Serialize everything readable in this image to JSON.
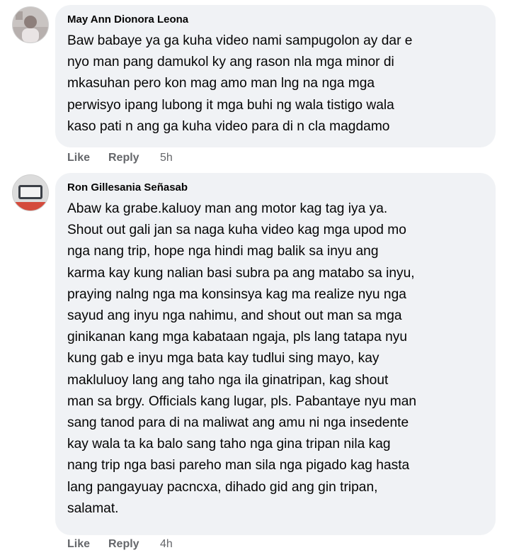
{
  "comments": [
    {
      "author": "May Ann Dionora Leona",
      "lines": [
        "Baw babaye ya ga kuha video nami sampugolon ay dar e",
        "nyo man pang damukol ky ang rason nla mga minor di",
        "mkasuhan pero kon mag amo man lng na nga mga",
        "perwisyo ipang lubong it mga buhi ng wala tistigo wala",
        "kaso pati n ang ga kuha video para di n cla magdamo"
      ],
      "like_label": "Like",
      "reply_label": "Reply",
      "time": "5h"
    },
    {
      "author": "Ron Gillesania Señasab",
      "lines": [
        "Abaw ka grabe.kaluoy man ang motor kag tag iya ya.",
        "Shout out gali jan sa naga kuha video kag mga upod mo",
        "nga nang trip, hope nga hindi mag balik sa inyu ang",
        "karma kay kung nalian basi subra pa ang matabo sa inyu,",
        "praying nalng nga ma konsinsya kag ma realize nyu nga",
        "sayud ang inyu nga nahimu, and shout out man sa mga",
        "ginikanan kang mga kabataan ngaja, pls lang tatapa nyu",
        "kung gab e inyu mga bata kay tudlui sing mayo, kay",
        "makluluoy lang ang taho nga ila ginatripan, kag shout",
        "man sa brgy. Officials kang lugar, pls. Pabantaye nyu man",
        "sang tanod para di na maliwat ang amu ni nga insedente",
        "kay wala ta ka balo sang taho nga gina tripan nila kag",
        "nang trip nga basi pareho man sila nga pigado kag hasta",
        "lang pangayuay pacncxa, dihado gid ang gin tripan,",
        "salamat."
      ],
      "like_label": "Like",
      "reply_label": "Reply",
      "time": "4h"
    }
  ]
}
